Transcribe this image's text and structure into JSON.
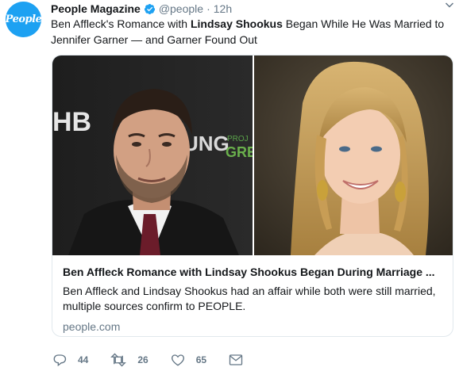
{
  "account": {
    "avatar_text": "People",
    "avatar_color": "#1da1f2",
    "name": "People Magazine",
    "handle": "@people",
    "separator": "·",
    "time": "12h"
  },
  "tweet": {
    "text_before": "Ben Affleck's Romance with ",
    "text_bold": "Lindsay Shookus",
    "text_after": " Began While He Was Married to Jennifer Garner — and Garner Found Out"
  },
  "card": {
    "left_photo_overlay_text": "HB",
    "left_photo_overlay_text2": "UNG",
    "left_photo_overlay_text3": "PROJ",
    "left_photo_overlay_text4": "GREE",
    "title": "Ben Affleck Romance with Lindsay Shookus Began During Marriage ...",
    "description": "Ben Affleck and Lindsay Shookus had an affair while both were still married, multiple sources confirm to PEOPLE.",
    "domain": "people.com"
  },
  "actions": {
    "reply_count": "44",
    "retweet_count": "26",
    "like_count": "65"
  },
  "icons": [
    "verified-icon",
    "caret-down-icon",
    "reply-icon",
    "retweet-icon",
    "like-icon",
    "message-icon"
  ]
}
